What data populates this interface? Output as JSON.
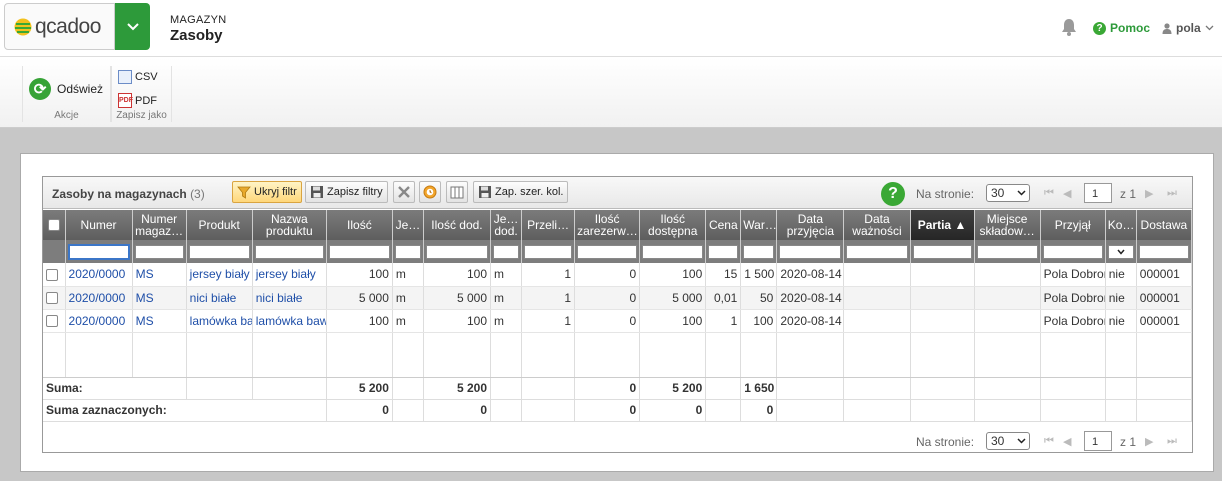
{
  "header": {
    "logo_text": "qcadoo",
    "section": "MAGAZYN",
    "page": "Zasoby",
    "help_label": "Pomoc",
    "user_label": "pola"
  },
  "ribbon": {
    "actions_group_label": "Akcje",
    "refresh_label": "Odśwież",
    "export_group_label": "Zapisz jako",
    "csv_label": "CSV",
    "pdf_label": "PDF"
  },
  "grid": {
    "title": "Zasoby na magazynach",
    "count": "(3)",
    "buttons": {
      "hide_filter": "Ukryj filtr",
      "save_filters": "Zapisz filtry",
      "save_widths": "Zap. szer. kol."
    },
    "per_page_label": "Na stronie:",
    "per_page_value": "30",
    "page_value": "1",
    "page_of": "z 1",
    "columns": [
      "Numer",
      "Numer magaz…",
      "Produkt",
      "Nazwa produktu",
      "Ilość",
      "Je…",
      "Ilość dod.",
      "Je… dod.",
      "Przeli…",
      "Ilość zarezerw…",
      "Ilość dostępna",
      "Cena",
      "War…",
      "Data przyjęcia",
      "Data ważności",
      "Partia",
      "Miejsce składow…",
      "Przyjął",
      "Ko…",
      "Dostawa"
    ],
    "rows": [
      [
        "2020/0000",
        "MS",
        "jersey biały",
        "jersey biały",
        "100",
        "m",
        "100",
        "m",
        "1",
        "0",
        "100",
        "15",
        "1 500",
        "2020-08-14",
        "",
        "",
        "",
        "Pola Dobroń",
        "nie",
        "000001"
      ],
      [
        "2020/0000",
        "MS",
        "nici białe",
        "nici białe",
        "5 000",
        "m",
        "5 000",
        "m",
        "1",
        "0",
        "5 000",
        "0,01",
        "50",
        "2020-08-14",
        "",
        "",
        "",
        "Pola Dobroń",
        "nie",
        "000001"
      ],
      [
        "2020/0000",
        "MS",
        "lamówka ba",
        "lamówka baw",
        "100",
        "m",
        "100",
        "m",
        "1",
        "0",
        "100",
        "1",
        "100",
        "2020-08-14",
        "",
        "",
        "",
        "Pola Dobroń",
        "nie",
        "000001"
      ]
    ],
    "sum_label": "Suma:",
    "sum_values": [
      "5 200",
      "5 200",
      "0",
      "5 200",
      "1 650"
    ],
    "selected_sum_label": "Suma zaznaczonych:",
    "selected_sum_values": [
      "0",
      "0",
      "0",
      "0",
      "0"
    ]
  },
  "colors": {
    "brand_green": "#2d9a3a",
    "link_blue": "#1f4fa8",
    "header_gray": "#6b6b6b"
  }
}
